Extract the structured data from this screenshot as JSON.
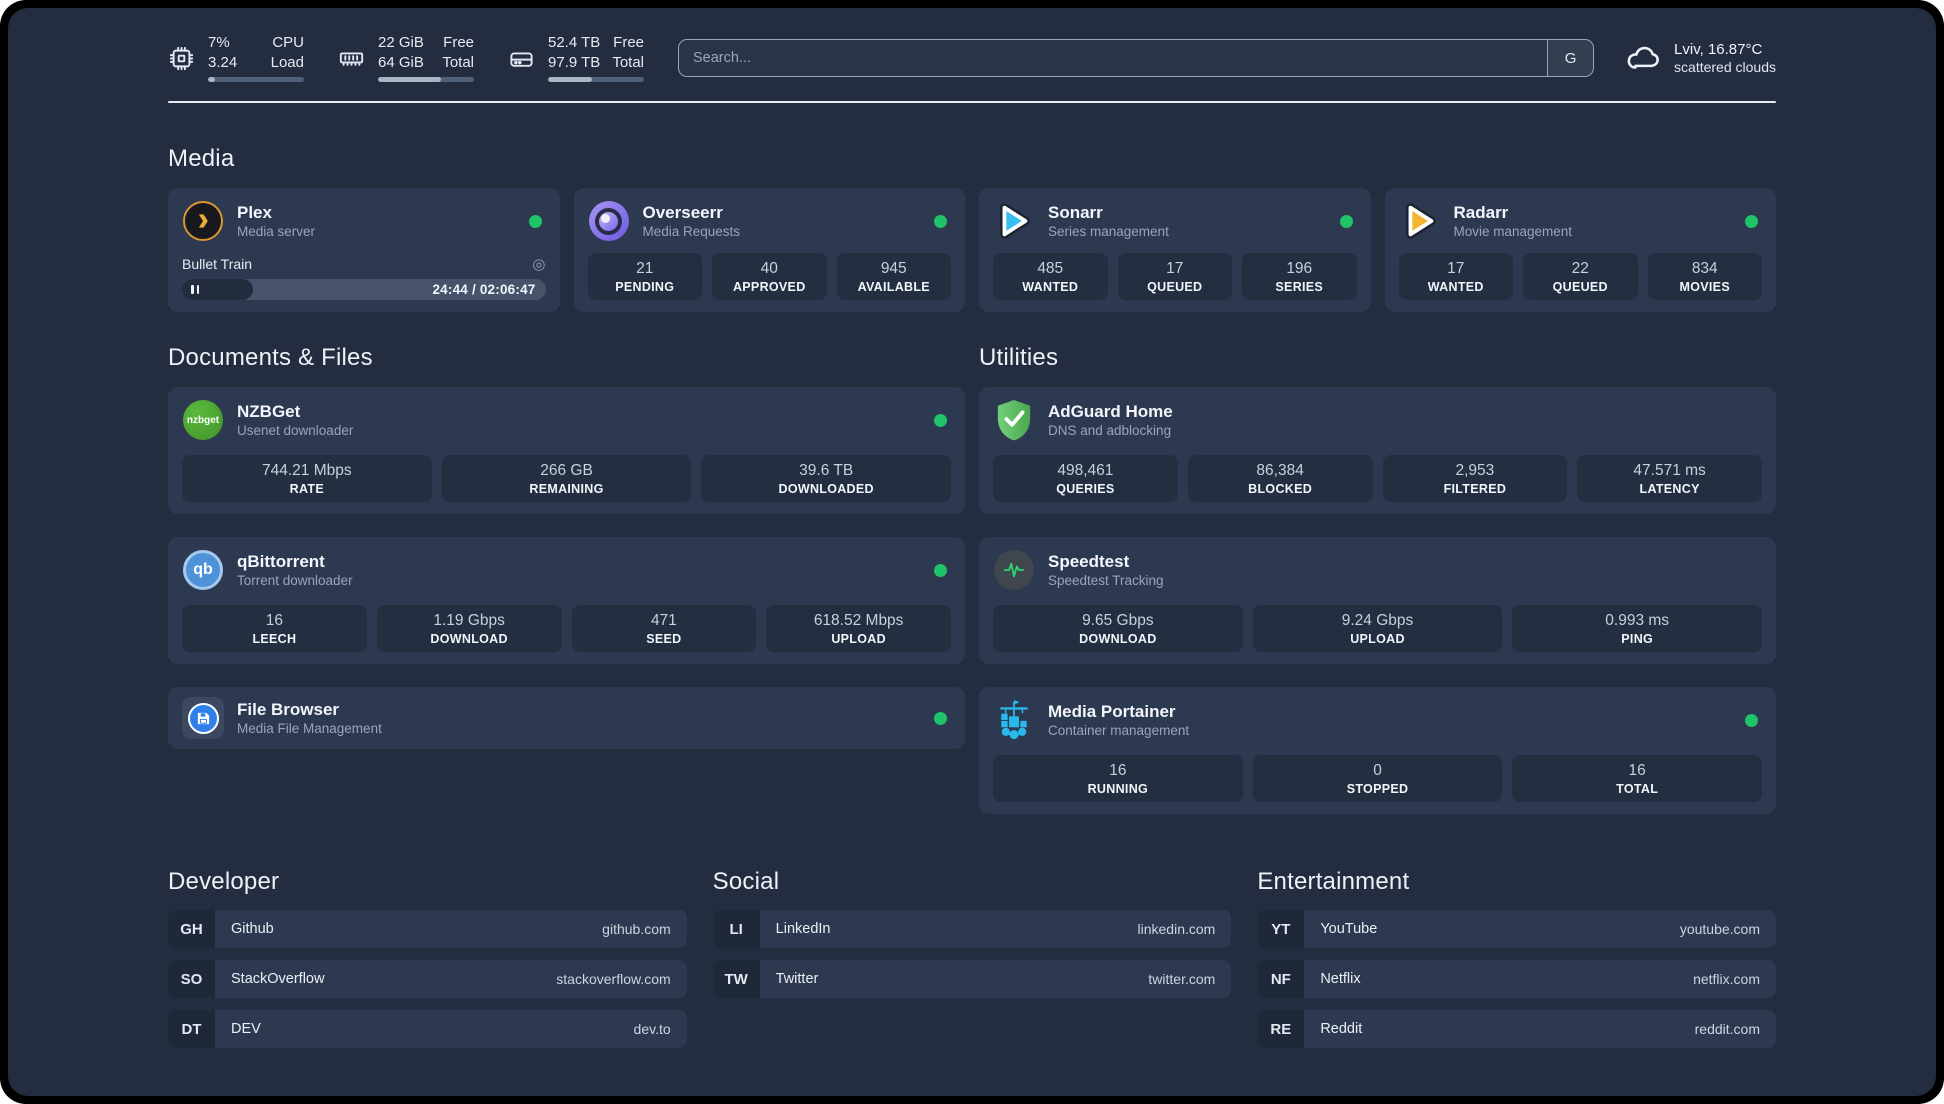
{
  "topbar": {
    "cpu": {
      "value_line1": "7%",
      "value_line2": "3.24",
      "label_line1": "CPU",
      "label_line2": "Load",
      "progress_pct": 7
    },
    "memory": {
      "value_line1": "22 GiB",
      "value_line2": "64 GiB",
      "label_line1": "Free",
      "label_line2": "Total",
      "progress_pct": 66
    },
    "storage": {
      "value_line1": "52.4 TB",
      "value_line2": "97.9 TB",
      "label_line1": "Free",
      "label_line2": "Total",
      "progress_pct": 46
    },
    "search": {
      "placeholder": "Search...",
      "button_label": "G"
    },
    "weather": {
      "location": "Lviv, 16.87°C",
      "condition": "scattered clouds"
    }
  },
  "sections": {
    "media": {
      "title": "Media",
      "cards": {
        "plex": {
          "name": "Plex",
          "description": "Media server",
          "status": "online",
          "now_playing": {
            "title": "Bullet Train",
            "time": "24:44 / 02:06:47",
            "progress_pct": 19.5
          }
        },
        "overseerr": {
          "name": "Overseerr",
          "description": "Media Requests",
          "status": "online",
          "stats": [
            {
              "value": "21",
              "label": "PENDING"
            },
            {
              "value": "40",
              "label": "APPROVED"
            },
            {
              "value": "945",
              "label": "AVAILABLE"
            }
          ]
        },
        "sonarr": {
          "name": "Sonarr",
          "description": "Series management",
          "status": "online",
          "stats": [
            {
              "value": "485",
              "label": "WANTED"
            },
            {
              "value": "17",
              "label": "QUEUED"
            },
            {
              "value": "196",
              "label": "SERIES"
            }
          ]
        },
        "radarr": {
          "name": "Radarr",
          "description": "Movie management",
          "status": "online",
          "stats": [
            {
              "value": "17",
              "label": "WANTED"
            },
            {
              "value": "22",
              "label": "QUEUED"
            },
            {
              "value": "834",
              "label": "MOVIES"
            }
          ]
        }
      }
    },
    "documents": {
      "title": "Documents & Files",
      "cards": {
        "nzbget": {
          "name": "NZBGet",
          "description": "Usenet downloader",
          "status": "online",
          "icon_text": "nzbget",
          "stats": [
            {
              "value": "744.21 Mbps",
              "label": "RATE"
            },
            {
              "value": "266 GB",
              "label": "REMAINING"
            },
            {
              "value": "39.6 TB",
              "label": "DOWNLOADED"
            }
          ]
        },
        "qbittorrent": {
          "name": "qBittorrent",
          "description": "Torrent downloader",
          "status": "online",
          "icon_text": "qb",
          "stats": [
            {
              "value": "16",
              "label": "LEECH"
            },
            {
              "value": "1.19 Gbps",
              "label": "DOWNLOAD"
            },
            {
              "value": "471",
              "label": "SEED"
            },
            {
              "value": "618.52 Mbps",
              "label": "UPLOAD"
            }
          ]
        },
        "filebrowser": {
          "name": "File Browser",
          "description": "Media File Management",
          "status": "online"
        }
      }
    },
    "utilities": {
      "title": "Utilities",
      "cards": {
        "adguard": {
          "name": "AdGuard Home",
          "description": "DNS and adblocking",
          "stats": [
            {
              "value": "498,461",
              "label": "QUERIES"
            },
            {
              "value": "86,384",
              "label": "BLOCKED"
            },
            {
              "value": "2,953",
              "label": "FILTERED"
            },
            {
              "value": "47.571 ms",
              "label": "LATENCY"
            }
          ]
        },
        "speedtest": {
          "name": "Speedtest",
          "description": "Speedtest Tracking",
          "stats": [
            {
              "value": "9.65 Gbps",
              "label": "DOWNLOAD"
            },
            {
              "value": "9.24 Gbps",
              "label": "UPLOAD"
            },
            {
              "value": "0.993 ms",
              "label": "PING"
            }
          ]
        },
        "portainer": {
          "name": "Media Portainer",
          "description": "Container management",
          "status": "online",
          "stats": [
            {
              "value": "16",
              "label": "RUNNING"
            },
            {
              "value": "0",
              "label": "STOPPED"
            },
            {
              "value": "16",
              "label": "TOTAL"
            }
          ]
        }
      }
    },
    "bookmarks": {
      "developer": {
        "title": "Developer",
        "items": [
          {
            "abbr": "GH",
            "label": "Github",
            "url": "github.com"
          },
          {
            "abbr": "SO",
            "label": "StackOverflow",
            "url": "stackoverflow.com"
          },
          {
            "abbr": "DT",
            "label": "DEV",
            "url": "dev.to"
          }
        ]
      },
      "social": {
        "title": "Social",
        "items": [
          {
            "abbr": "LI",
            "label": "LinkedIn",
            "url": "linkedin.com"
          },
          {
            "abbr": "TW",
            "label": "Twitter",
            "url": "twitter.com"
          }
        ]
      },
      "entertainment": {
        "title": "Entertainment",
        "items": [
          {
            "abbr": "YT",
            "label": "YouTube",
            "url": "youtube.com"
          },
          {
            "abbr": "NF",
            "label": "Netflix",
            "url": "netflix.com"
          },
          {
            "abbr": "RE",
            "label": "Reddit",
            "url": "reddit.com"
          }
        ]
      }
    }
  },
  "colors": {
    "background": "#232d3f",
    "card": "#2d3950",
    "stat_box": "#232e41",
    "status_online": "#1fc468",
    "plex_gold": "#e9ad33",
    "sonarr_blue": "#38bff0",
    "radarr_yellow": "#f5b52e",
    "nzbget_green": "#4caf2f",
    "qbittorrent_blue": "#4e93d9",
    "filebrowser_blue": "#2f80e8",
    "adguard_green": "#59c25d",
    "speedtest_green": "#2dd673",
    "portainer_blue": "#29b8eb"
  },
  "icons": [
    "cpu-icon",
    "ram-icon",
    "hard-drive-icon",
    "cloud-icon",
    "plex-icon",
    "overseerr-icon",
    "sonarr-icon",
    "radarr-icon",
    "nzbget-icon",
    "qbittorrent-icon",
    "filebrowser-icon",
    "adguard-icon",
    "speedtest-icon",
    "portainer-icon",
    "pause-icon",
    "webcam-icon"
  ]
}
